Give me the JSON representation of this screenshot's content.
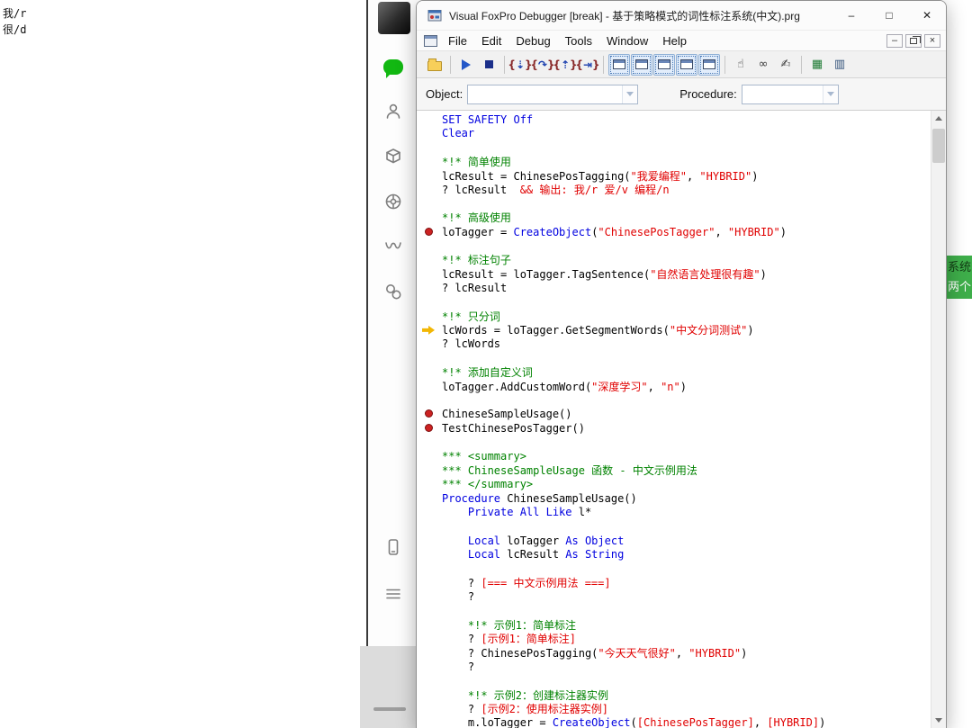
{
  "desktop": {
    "stray_text": "我/r\n很/d",
    "peek_lines": [
      "系统",
      "两个"
    ]
  },
  "sidebar": {
    "icons": [
      "user-avatar",
      "chats",
      "contacts",
      "favorites",
      "moments",
      "channels",
      "mini-programs",
      "phone",
      "more-menu"
    ]
  },
  "window": {
    "title": "Visual FoxPro Debugger [break] - 基于策略模式的词性标注系统(中文).prg",
    "controls": {
      "minimize": "–",
      "maximize": "□",
      "close": "✕"
    }
  },
  "menubar": {
    "items": [
      "File",
      "Edit",
      "Debug",
      "Tools",
      "Window",
      "Help"
    ],
    "mdi": {
      "minimize": "–",
      "close": "×"
    }
  },
  "toolbar": {
    "buttons": [
      {
        "name": "open-button",
        "kind": "folder"
      },
      {
        "kind": "sep"
      },
      {
        "name": "resume-button",
        "kind": "run"
      },
      {
        "name": "cancel-button",
        "kind": "stop"
      },
      {
        "kind": "sep"
      },
      {
        "name": "step-into-button",
        "kind": "step",
        "glyph": "⇣"
      },
      {
        "name": "step-over-button",
        "kind": "step",
        "glyph": "↷"
      },
      {
        "name": "step-out-button",
        "kind": "step",
        "glyph": "⇡"
      },
      {
        "name": "run-to-cursor-button",
        "kind": "step",
        "glyph": "⇥"
      },
      {
        "kind": "sep"
      },
      {
        "name": "trace-window-button",
        "kind": "win",
        "pressed": true
      },
      {
        "name": "watch-window-button",
        "kind": "win",
        "pressed": true
      },
      {
        "name": "locals-window-button",
        "kind": "win",
        "pressed": true
      },
      {
        "name": "output-window-button",
        "kind": "win",
        "pressed": true
      },
      {
        "name": "callstack-window-button",
        "kind": "win",
        "pressed": true
      },
      {
        "kind": "sep"
      },
      {
        "name": "toggle-breakpoint-button",
        "kind": "glyph",
        "glyph": "☝"
      },
      {
        "name": "watch-expression-button",
        "kind": "glyph",
        "glyph": "∞"
      },
      {
        "name": "clear-debug-output-button",
        "kind": "glyph",
        "glyph": "✍"
      },
      {
        "kind": "sep"
      },
      {
        "name": "coverage-logging-button",
        "kind": "glyph",
        "glyph": "▦",
        "color": "#1d7a33"
      },
      {
        "name": "event-tracking-button",
        "kind": "glyph",
        "glyph": "▥",
        "color": "#33527a"
      }
    ]
  },
  "object_row": {
    "object_label": "Object:",
    "object_value": "",
    "procedure_label": "Procedure:",
    "procedure_value": ""
  },
  "code": {
    "lines": [
      {
        "m": "",
        "s": [
          [
            "k",
            "SET SAFETY Off"
          ]
        ]
      },
      {
        "m": "",
        "s": [
          [
            "k",
            "Clear"
          ]
        ]
      },
      {
        "m": "",
        "s": []
      },
      {
        "m": "",
        "s": [
          [
            "c",
            "*!* 简单使用"
          ]
        ]
      },
      {
        "m": "",
        "s": [
          [
            "t",
            "lcResult = ChinesePosTagging("
          ],
          [
            "s",
            "\"我爱编程\""
          ],
          [
            "t",
            ", "
          ],
          [
            "s",
            "\"HYBRID\""
          ],
          [
            "t",
            ")"
          ]
        ]
      },
      {
        "m": "",
        "s": [
          [
            "t",
            "? lcResult  "
          ],
          [
            "s",
            "&& 输出: 我/r 爱/v 编程/n"
          ]
        ]
      },
      {
        "m": "",
        "s": []
      },
      {
        "m": "",
        "s": [
          [
            "c",
            "*!* 高级使用"
          ]
        ]
      },
      {
        "m": "bp",
        "s": [
          [
            "t",
            "loTagger = "
          ],
          [
            "k",
            "CreateObject"
          ],
          [
            "t",
            "("
          ],
          [
            "s",
            "\"ChinesePosTagger\""
          ],
          [
            "t",
            ", "
          ],
          [
            "s",
            "\"HYBRID\""
          ],
          [
            "t",
            ")"
          ]
        ]
      },
      {
        "m": "",
        "s": []
      },
      {
        "m": "",
        "s": [
          [
            "c",
            "*!* 标注句子"
          ]
        ]
      },
      {
        "m": "",
        "s": [
          [
            "t",
            "lcResult = loTagger.TagSentence("
          ],
          [
            "s",
            "\"自然语言处理很有趣\""
          ],
          [
            "t",
            ")"
          ]
        ]
      },
      {
        "m": "",
        "s": [
          [
            "t",
            "? lcResult"
          ]
        ]
      },
      {
        "m": "",
        "s": []
      },
      {
        "m": "",
        "s": [
          [
            "c",
            "*!* 只分词"
          ]
        ]
      },
      {
        "m": "cur",
        "s": [
          [
            "t",
            "lcWords = loTagger.GetSegmentWords("
          ],
          [
            "s",
            "\"中文分词测试\""
          ],
          [
            "t",
            ")"
          ]
        ]
      },
      {
        "m": "",
        "s": [
          [
            "t",
            "? lcWords"
          ]
        ]
      },
      {
        "m": "",
        "s": []
      },
      {
        "m": "",
        "s": [
          [
            "c",
            "*!* 添加自定义词"
          ]
        ]
      },
      {
        "m": "",
        "s": [
          [
            "t",
            "loTagger.AddCustomWord("
          ],
          [
            "s",
            "\"深度学习\""
          ],
          [
            "t",
            ", "
          ],
          [
            "s",
            "\"n\""
          ],
          [
            "t",
            ")"
          ]
        ]
      },
      {
        "m": "",
        "s": []
      },
      {
        "m": "bp",
        "s": [
          [
            "t",
            "ChineseSampleUsage()"
          ]
        ]
      },
      {
        "m": "bp",
        "s": [
          [
            "t",
            "TestChinesePosTagger()"
          ]
        ]
      },
      {
        "m": "",
        "s": []
      },
      {
        "m": "",
        "s": [
          [
            "c",
            "*** <summary>"
          ]
        ]
      },
      {
        "m": "",
        "s": [
          [
            "c",
            "*** ChineseSampleUsage 函数 - 中文示例用法"
          ]
        ]
      },
      {
        "m": "",
        "s": [
          [
            "c",
            "*** </summary>"
          ]
        ]
      },
      {
        "m": "",
        "s": [
          [
            "k",
            "Procedure"
          ],
          [
            "t",
            " ChineseSampleUsage()"
          ]
        ]
      },
      {
        "m": "",
        "s": [
          [
            "t",
            "    "
          ],
          [
            "k",
            "Private All Like"
          ],
          [
            "t",
            " l*"
          ]
        ]
      },
      {
        "m": "",
        "s": []
      },
      {
        "m": "",
        "s": [
          [
            "t",
            "    "
          ],
          [
            "k",
            "Local"
          ],
          [
            "t",
            " loTagger "
          ],
          [
            "k",
            "As Object"
          ]
        ]
      },
      {
        "m": "",
        "s": [
          [
            "t",
            "    "
          ],
          [
            "k",
            "Local"
          ],
          [
            "t",
            " lcResult "
          ],
          [
            "k",
            "As String"
          ]
        ]
      },
      {
        "m": "",
        "s": []
      },
      {
        "m": "",
        "s": [
          [
            "t",
            "    ? "
          ],
          [
            "s",
            "[=== 中文示例用法 ===]"
          ]
        ]
      },
      {
        "m": "",
        "s": [
          [
            "t",
            "    ?"
          ]
        ]
      },
      {
        "m": "",
        "s": []
      },
      {
        "m": "",
        "s": [
          [
            "c",
            "    *!* 示例1：简单标注"
          ]
        ]
      },
      {
        "m": "",
        "s": [
          [
            "t",
            "    ? "
          ],
          [
            "s",
            "[示例1：简单标注]"
          ]
        ]
      },
      {
        "m": "",
        "s": [
          [
            "t",
            "    ? ChinesePosTagging("
          ],
          [
            "s",
            "\"今天天气很好\""
          ],
          [
            "t",
            ", "
          ],
          [
            "s",
            "\"HYBRID\""
          ],
          [
            "t",
            ")"
          ]
        ]
      },
      {
        "m": "",
        "s": [
          [
            "t",
            "    ?"
          ]
        ]
      },
      {
        "m": "",
        "s": []
      },
      {
        "m": "",
        "s": [
          [
            "c",
            "    *!* 示例2：创建标注器实例"
          ]
        ]
      },
      {
        "m": "",
        "s": [
          [
            "t",
            "    ? "
          ],
          [
            "s",
            "[示例2：使用标注器实例]"
          ]
        ]
      },
      {
        "m": "",
        "s": [
          [
            "t",
            "    m.loTagger = "
          ],
          [
            "k",
            "CreateObject"
          ],
          [
            "t",
            "("
          ],
          [
            "s",
            "[ChinesePosTagger]"
          ],
          [
            "t",
            ", "
          ],
          [
            "s",
            "[HYBRID]"
          ],
          [
            "t",
            ")"
          ]
        ]
      }
    ]
  }
}
